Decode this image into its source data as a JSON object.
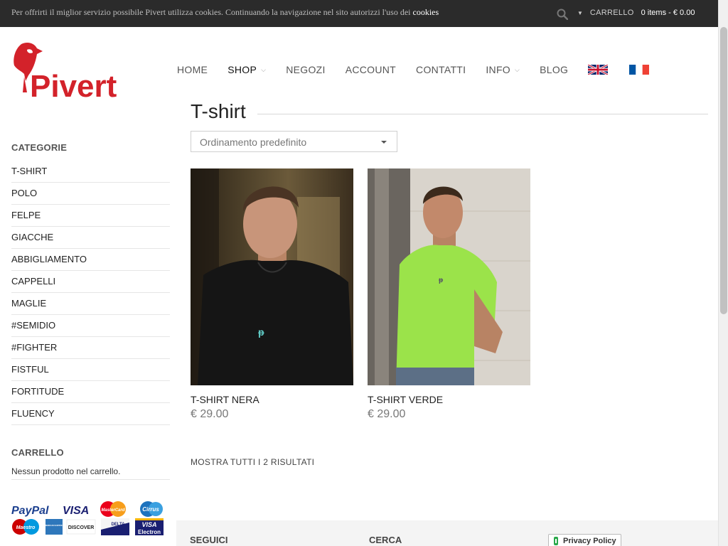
{
  "topbar": {
    "cookie_text": "Per offrirti il miglior servizio possibile Pivert utilizza cookies. Continuando la navigazione nel sito autorizzi l'uso dei",
    "cookie_link": "cookies",
    "cart_label": "CARRELLO",
    "cart_items": "0 items - € 0.00"
  },
  "logo": {
    "text": "Pivert"
  },
  "nav": {
    "items": [
      {
        "label": "HOME"
      },
      {
        "label": "SHOP"
      },
      {
        "label": "NEGOZI"
      },
      {
        "label": "ACCOUNT"
      },
      {
        "label": "CONTATTI"
      },
      {
        "label": "INFO"
      },
      {
        "label": "BLOG"
      }
    ]
  },
  "page": {
    "title": "T-shirt",
    "sort_value": "Ordinamento predefinito",
    "results_text": "MOSTRA TUTTI I 2 RISULTATI"
  },
  "sidebar": {
    "categories_heading": "CATEGORIE",
    "categories": [
      "T-SHIRT",
      "POLO",
      "FELPE",
      "GIACCHE",
      "ABBIGLIAMENTO",
      "CAPPELLI",
      "MAGLIE",
      "#SEMIDIO",
      "#FIGHTER",
      "FISTFUL",
      "FORTITUDE",
      "FLUENCY"
    ],
    "cart_heading": "CARRELLO",
    "cart_empty": "Nessun prodotto nel carrello."
  },
  "payments": {
    "paypal": "PayPal",
    "visa": "VISA",
    "mastercard": "MasterCard",
    "cirrus": "Cirrus",
    "maestro": "Maestro",
    "amex": "AMERICAN EXPRESS",
    "discover": "DISCOVER",
    "delta": "DELTA",
    "visa_electron_1": "VISA",
    "visa_electron_2": "Electron"
  },
  "products": [
    {
      "name": "T-SHIRT NERA",
      "price": "€ 29.00",
      "shirt_color": "#151515"
    },
    {
      "name": "T-SHIRT VERDE",
      "price": "€ 29.00",
      "shirt_color": "#9be34a"
    }
  ],
  "footer": {
    "follow": "SEGUICI",
    "search": "CERCA",
    "privacy": "Privacy Policy"
  },
  "colors": {
    "brand_red": "#d3222a",
    "topbar": "#2b2b2b"
  }
}
